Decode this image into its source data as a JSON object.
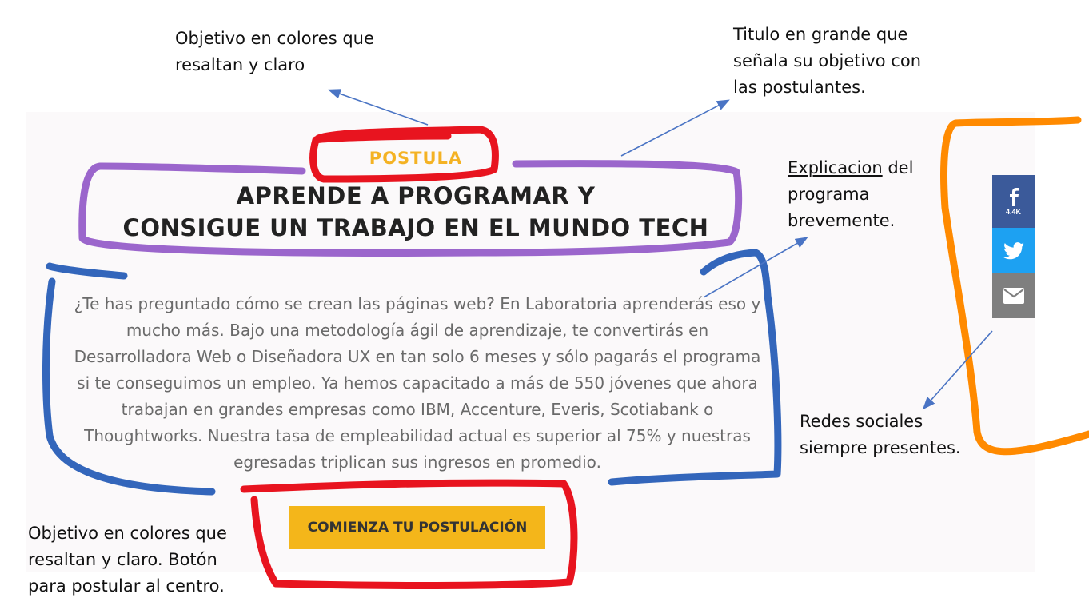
{
  "colors": {
    "accent": "#f4b223",
    "button": "#f4b61a",
    "facebook": "#3b5a9a",
    "twitter": "#1da1f2",
    "email": "#7f7f7f",
    "highlight_red": "#e8141f",
    "highlight_purple": "#9b66cc",
    "highlight_blue": "#3366bb",
    "highlight_orange": "#ff8a00",
    "arrow": "#4a74c4"
  },
  "page": {
    "eyebrow": "POSTULA",
    "title_line1": "APRENDE A PROGRAMAR Y",
    "title_line2": "CONSIGUE UN TRABAJO EN EL MUNDO TECH",
    "body_lines": [
      "¿Te has preguntado cómo se crean las páginas web? En Laboratoria aprenderás eso y",
      "mucho más. Bajo una metodología ágil de aprendizaje, te convertirás en",
      "Desarrolladora Web o Diseñadora UX en tan solo 6 meses y sólo pagarás el programa",
      "si te conseguimos un empleo. Ya hemos capacitado a más de 550 jóvenes que ahora",
      "trabajan en grandes empresas como IBM, Accenture, Everis, Scotiabank o",
      "Thoughtworks. Nuestra tasa de empleabilidad actual es superior al 75% y nuestras",
      "egresadas triplican sus ingresos en promedio."
    ],
    "cta_label": "COMIENZA TU POSTULACIÓN"
  },
  "share": {
    "facebook_icon": "facebook-icon",
    "facebook_count": "4.4K",
    "twitter_icon": "twitter-icon",
    "email_icon": "envelope-icon"
  },
  "annotations": {
    "eyebrow_note": "Objetivo en colores que\nresaltan y claro",
    "title_note": "Titulo en grande que\nseñala su objetivo con\nlas postulantes.",
    "explain_note_word": "Explicacion",
    "explain_note_rest": " del\nprograma\nbrevemente.",
    "social_note": "Redes sociales\nsiempre presentes.",
    "cta_note": "Objetivo en colores que\nresaltan y claro. Botón\npara postular al centro."
  }
}
